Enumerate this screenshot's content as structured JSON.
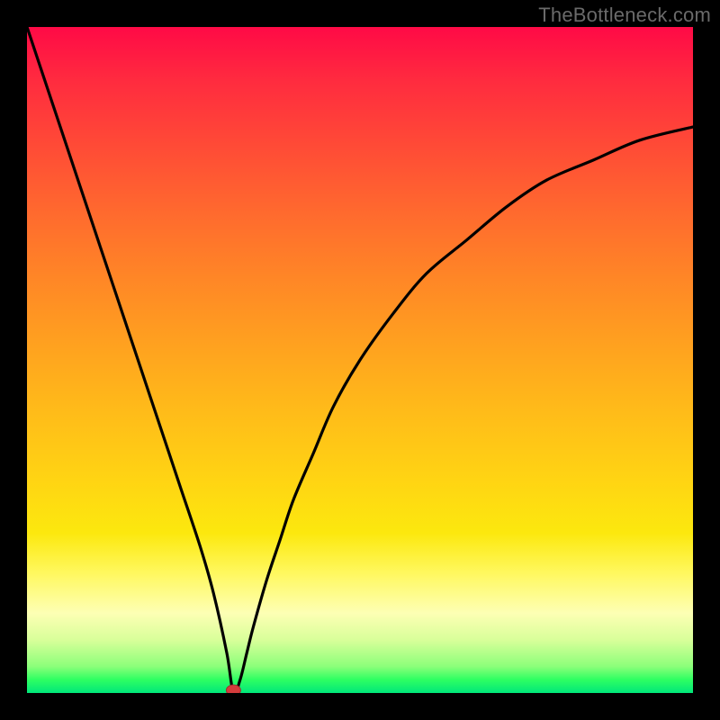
{
  "watermark": {
    "text": "TheBottleneck.com"
  },
  "colors": {
    "background": "#000000",
    "curve": "#000000",
    "marker_fill": "#d43c3c",
    "marker_stroke": "#a12e2e"
  },
  "chart_data": {
    "type": "line",
    "title": "",
    "xlabel": "",
    "ylabel": "",
    "xlim": [
      0,
      100
    ],
    "ylim": [
      0,
      100
    ],
    "grid": false,
    "annotations": [
      {
        "type": "marker",
        "x": 31,
        "y": 0,
        "label": "minimum"
      }
    ],
    "series": [
      {
        "name": "bottleneck-curve",
        "x": [
          0,
          2,
          5,
          8,
          11,
          14,
          17,
          20,
          23,
          26,
          28,
          30,
          31,
          32,
          33,
          34,
          36,
          38,
          40,
          43,
          46,
          50,
          55,
          60,
          66,
          72,
          78,
          85,
          92,
          100
        ],
        "y": [
          100,
          94,
          85,
          76,
          67,
          58,
          49,
          40,
          31,
          22,
          15,
          6,
          0,
          2,
          6,
          10,
          17,
          23,
          29,
          36,
          43,
          50,
          57,
          63,
          68,
          73,
          77,
          80,
          83,
          85
        ]
      }
    ]
  }
}
